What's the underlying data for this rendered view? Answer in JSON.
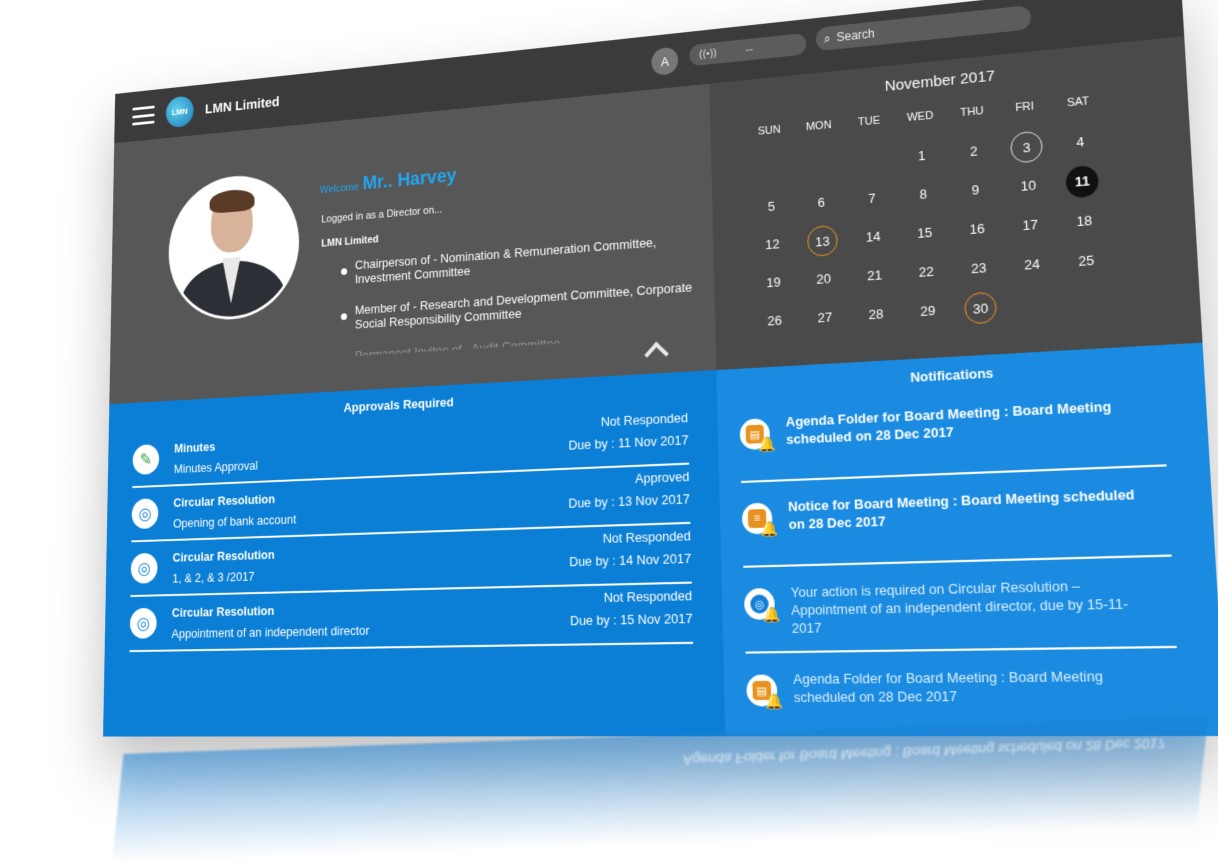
{
  "header": {
    "app_title": "LMN Limited",
    "logo_text": "LMN",
    "avatar_letter": "A",
    "signal_text": "--",
    "search_placeholder": "Search"
  },
  "profile": {
    "welcome_label": "Welcome",
    "name": "Mr.. Harvey",
    "logged_in_as": "Logged in as a Director on...",
    "company": "LMN Limited",
    "roles": [
      "Chairperson of - Nomination & Remuneration Committee, Investment Committee",
      "Member of - Research and Development Committee, Corporate Social Responsibility Committee",
      "Permanent Invitee of - Audit Committee"
    ]
  },
  "calendar": {
    "title": "November 2017",
    "weekdays": [
      "SUN",
      "MON",
      "TUE",
      "WED",
      "THU",
      "FRI",
      "SAT"
    ]
  },
  "approvals": {
    "title": "Approvals Required",
    "items": [
      {
        "title": "Minutes",
        "subtitle": "Minutes Approval",
        "status": "Not Responded",
        "due": "Due by : 11 Nov 2017"
      },
      {
        "title": "Circular Resolution",
        "subtitle": "Opening of bank account",
        "status": "Approved",
        "due": "Due by : 13 Nov 2017"
      },
      {
        "title": "Circular Resolution",
        "subtitle": "1, & 2, & 3 /2017",
        "status": "Not Responded",
        "due": "Due by : 14 Nov 2017"
      },
      {
        "title": "Circular Resolution",
        "subtitle": "Appointment of an independent director",
        "status": "Not Responded",
        "due": "Due by : 15 Nov 2017"
      }
    ]
  },
  "notifications": {
    "title": "Notifications",
    "items": [
      {
        "text": "Agenda Folder for Board Meeting : Board Meeting scheduled on 28 Dec 2017"
      },
      {
        "text": "Notice for Board Meeting : Board Meeting scheduled on 28 Dec 2017"
      },
      {
        "text": "Your action is required on Circular Resolution – Appointment of an independent director, due by 15-11-2017"
      },
      {
        "text": "Agenda Folder for Board Meeting : Board Meeting scheduled on 28 Dec 2017"
      }
    ]
  },
  "colors": {
    "topbar": "#3b3b3b",
    "profile_bg": "#575757",
    "calendar_bg": "#4a4a4a",
    "approvals_bg": "#0b7fd6",
    "notifications_bg": "#1a8be0",
    "accent_orange": "#e8931f",
    "welcome_blue": "#22a6f0"
  }
}
